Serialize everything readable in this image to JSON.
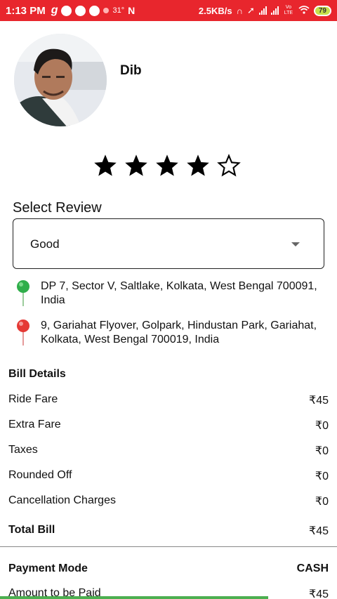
{
  "status_bar": {
    "time": "1:13 PM",
    "temp": "31°",
    "speed": "2.5KB/s",
    "volte": "Vo LTE",
    "battery": "79"
  },
  "driver": {
    "name": "Dib"
  },
  "rating": {
    "value": 4,
    "max": 5
  },
  "review": {
    "label": "Select Review",
    "selected": "Good"
  },
  "locations": {
    "pickup": "DP 7, Sector V, Saltlake, Kolkata, West Bengal 700091, India",
    "drop": "9, Gariahat Flyover, Golpark, Hindustan Park, Gariahat, Kolkata, West Bengal 700019, India"
  },
  "bill": {
    "title": "Bill Details",
    "items": [
      {
        "label": "Ride Fare",
        "amount": "₹45"
      },
      {
        "label": "Extra Fare",
        "amount": "₹0"
      },
      {
        "label": "Taxes",
        "amount": "₹0"
      },
      {
        "label": "Rounded Off",
        "amount": "₹0"
      },
      {
        "label": "Cancellation Charges",
        "amount": "₹0"
      }
    ],
    "total_label": "Total Bill",
    "total_amount": "₹45"
  },
  "payment": {
    "mode_label": "Payment Mode",
    "mode_value": "CASH",
    "amount_label": "Amount to be Paid",
    "amount_value": "₹45"
  },
  "colors": {
    "status_bar": "#e8262d",
    "pickup_pin": "#2fae4a",
    "drop_pin": "#e53935",
    "progress": "#4caf50"
  }
}
